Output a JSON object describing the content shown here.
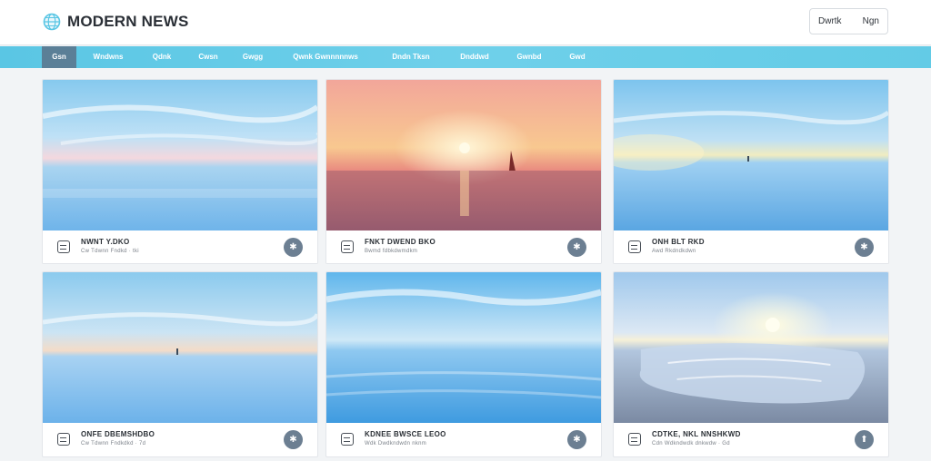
{
  "brand": {
    "name": "MODERN NEWS",
    "icon": "globe-icon",
    "accent": "#63cbe6",
    "nav_active": "#5b7f97"
  },
  "header": {
    "button_left": "Dwrtk",
    "button_right": "Ngn"
  },
  "nav": {
    "items": [
      {
        "label": "Gsn",
        "active": true
      },
      {
        "label": "Wndwns"
      },
      {
        "label": "Qdnk"
      },
      {
        "label": "Cwsn"
      },
      {
        "label": "Gwgg"
      },
      {
        "label": "Qwnk Gwnnnnnws"
      },
      {
        "label": "Dndn Tksn"
      },
      {
        "label": "Dnddwd"
      },
      {
        "label": "Gwnbd"
      },
      {
        "label": "Gwd"
      }
    ]
  },
  "cards": [
    {
      "title": "NWNT Y.DKO",
      "meta": "Cw Tdwnn Fndkd · tki",
      "icon": "card-icon"
    },
    {
      "title": "FNKT DWEND BKO",
      "meta": "Bwmd fdbkdwmdkm",
      "icon": "card-icon"
    },
    {
      "title": "ONH BLT RKD",
      "meta": "Awd Rkdndkdwn",
      "icon": "card-icon"
    },
    {
      "title": "ONFE DBEMSHDBO",
      "meta": "Cw Tdwnn Fndkdkd · 7d",
      "icon": "card-icon"
    },
    {
      "title": "KDNEE BWSCE LEOO",
      "meta": "Wdk Dwdkndwdn nknm",
      "icon": "card-icon"
    },
    {
      "title": "CDTKE, NKL NNSHKWD",
      "meta": "Cdn Wdkndwdk dnkwdw · Gd",
      "icon": "card-icon"
    }
  ]
}
